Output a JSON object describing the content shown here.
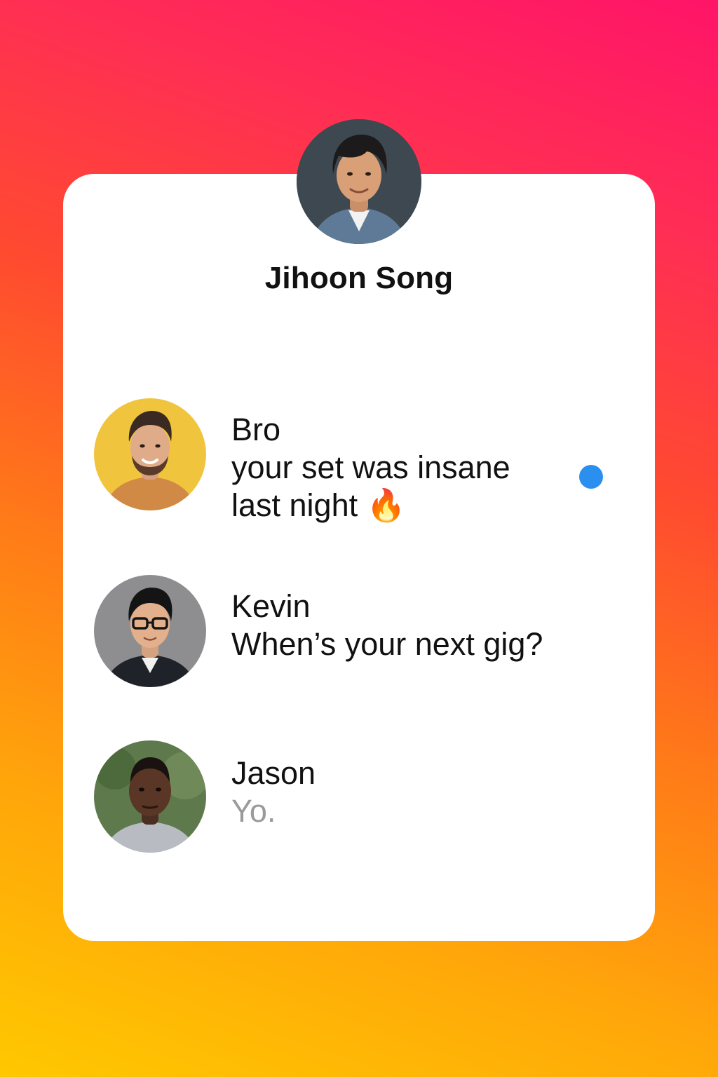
{
  "profile": {
    "name": "Jihoon Song",
    "avatar_icon": "profile-photo"
  },
  "conversations": [
    {
      "name": "Bro",
      "message": "your set was insane last night 🔥",
      "unread": true,
      "avatar_icon": "contact-photo"
    },
    {
      "name": "Kevin",
      "message": "When’s your next gig?",
      "unread": false,
      "avatar_icon": "contact-photo"
    },
    {
      "name": "Jason",
      "message": "Yo.",
      "unread": false,
      "avatar_icon": "contact-photo"
    }
  ],
  "colors": {
    "unread_dot": "#2b8ff0",
    "muted_text": "#9a9a9a",
    "gradient_top": "#ff1468",
    "gradient_bottom": "#ffc800"
  }
}
